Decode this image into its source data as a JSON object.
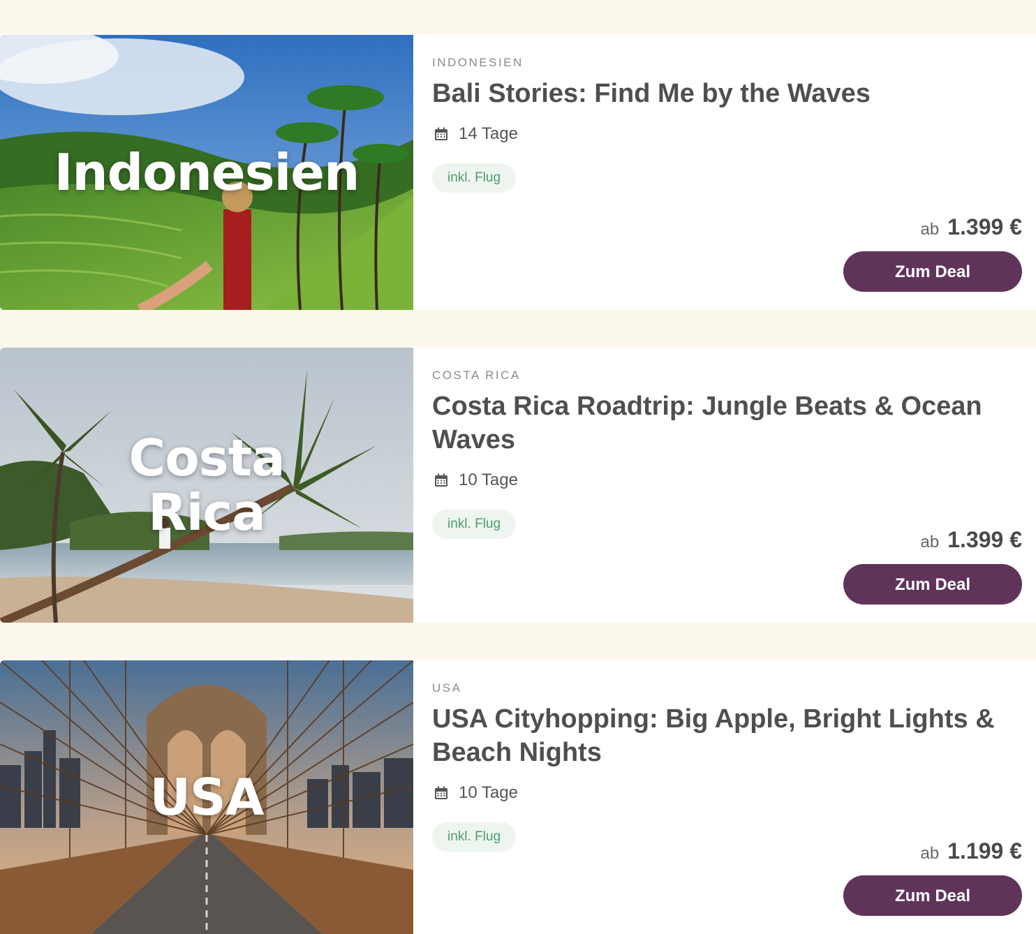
{
  "colors": {
    "page_background": "#fdf8ee",
    "button": "#60345a",
    "badge_background": "#eef5ef",
    "badge_text": "#4f9b6c"
  },
  "deals": [
    {
      "image_label": "Indonesien",
      "country": "INDONESIEN",
      "title": "Bali Stories: Find Me by the Waves",
      "duration": "14 Tage",
      "badge": "inkl. Flug",
      "price_prefix": "ab",
      "price": "1.399 €",
      "button_label": "Zum Deal"
    },
    {
      "image_label": "Costa Rica",
      "country": "COSTA RICA",
      "title": "Costa Rica Roadtrip: Jungle Beats & Ocean Waves",
      "duration": "10 Tage",
      "badge": "inkl. Flug",
      "price_prefix": "ab",
      "price": "1.399 €",
      "button_label": "Zum Deal"
    },
    {
      "image_label": "USA",
      "country": "USA",
      "title": "USA Cityhopping: Big Apple, Bright Lights & Beach Nights",
      "duration": "10 Tage",
      "badge": "inkl. Flug",
      "price_prefix": "ab",
      "price": "1.199 €",
      "button_label": "Zum Deal"
    }
  ]
}
